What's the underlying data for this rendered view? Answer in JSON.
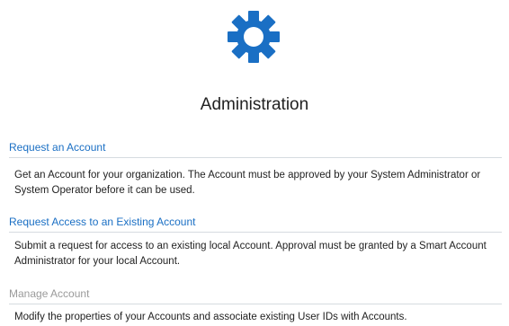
{
  "page": {
    "title": "Administration",
    "icon": "gear-icon",
    "accent_color": "#1a6fc4"
  },
  "sections": [
    {
      "link_label": "Request an Account",
      "enabled": true,
      "description": "Get an Account for your organization. The Account must be approved by your System Administrator or System Operator before it can be used."
    },
    {
      "link_label": "Request Access to an Existing Account",
      "enabled": true,
      "description": "Submit a request for access to an existing local Account. Approval must be granted by a Smart Account Administrator for your local Account."
    },
    {
      "link_label": "Manage Account",
      "enabled": false,
      "description": "Modify the properties of your Accounts and associate existing User IDs with Accounts."
    }
  ]
}
